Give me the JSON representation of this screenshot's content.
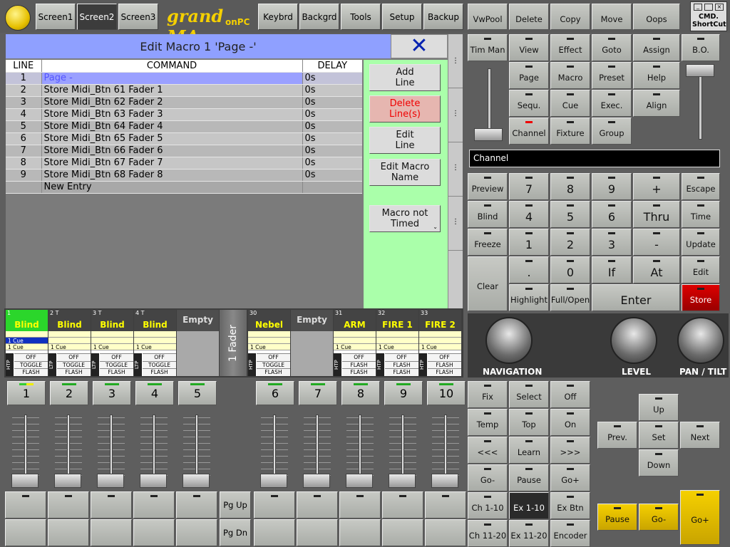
{
  "toolbar": {
    "screen1": "Screen1",
    "screen2": "Screen2",
    "screen3": "Screen3",
    "logo_main": "grand MA",
    "logo_sub": "onPC",
    "keybrd": "Keybrd",
    "backgrd": "Backgrd",
    "tools": "Tools",
    "setup": "Setup",
    "backup": "Backup",
    "cmd_shortcut": "CMD. ShortCut"
  },
  "macro": {
    "title": "Edit Macro 1 'Page -'",
    "col_line": "LINE",
    "col_command": "COMMAND",
    "col_delay": "DELAY",
    "rows": [
      {
        "line": "1",
        "command": "Page -",
        "delay": "0s"
      },
      {
        "line": "2",
        "command": "Store Midi_Btn 61 Fader 1",
        "delay": "0s"
      },
      {
        "line": "3",
        "command": "Store Midi_Btn 62 Fader 2",
        "delay": "0s"
      },
      {
        "line": "4",
        "command": "Store Midi_Btn 63 Fader 3",
        "delay": "0s"
      },
      {
        "line": "5",
        "command": "Store Midi_Btn 64 Fader 4",
        "delay": "0s"
      },
      {
        "line": "6",
        "command": "Store Midi_Btn 65 Fader 5",
        "delay": "0s"
      },
      {
        "line": "7",
        "command": "Store Midi_Btn 66 Fader 6",
        "delay": "0s"
      },
      {
        "line": "8",
        "command": "Store Midi_Btn 67 Fader 7",
        "delay": "0s"
      },
      {
        "line": "9",
        "command": "Store Midi_Btn 68 Fader 8",
        "delay": "0s"
      },
      {
        "line": "",
        "command": "New Entry",
        "delay": ""
      }
    ],
    "add_line": "Add Line",
    "delete_line": "Delete Line(s)",
    "edit_line": "Edit Line",
    "edit_name": "Edit Macro Name",
    "timed": "Macro not Timed"
  },
  "executors": [
    {
      "num": "1",
      "name": "Blind",
      "lines": [
        "1 Cue",
        "1 Cue"
      ],
      "side": "HTP",
      "btns": [
        "OFF",
        "TOGGLE",
        "FLASH"
      ]
    },
    {
      "num": "2 T",
      "name": "Blind",
      "lines": [
        "",
        "1 Cue"
      ],
      "side": "LTP",
      "btns": [
        "OFF",
        "TOGGLE",
        "FLASH"
      ]
    },
    {
      "num": "3 T",
      "name": "Blind",
      "lines": [
        "",
        "1 Cue"
      ],
      "side": "LTP",
      "btns": [
        "OFF",
        "TOGGLE",
        "FLASH"
      ]
    },
    {
      "num": "4 T",
      "name": "Blind",
      "lines": [
        "",
        "1 Cue"
      ],
      "side": "LTP",
      "btns": [
        "OFF",
        "TOGGLE",
        "FLASH"
      ]
    },
    {
      "num": "",
      "name": "Empty",
      "lines": [],
      "side": "",
      "btns": []
    },
    {
      "num": "30",
      "name": "Nebel",
      "lines": [
        "",
        "1 Cue"
      ],
      "side": "HTP",
      "btns": [
        "OFF",
        "TOGGLE",
        "FLASH"
      ]
    },
    {
      "num": "",
      "name": "Empty",
      "lines": [],
      "side": "",
      "btns": []
    },
    {
      "num": "31",
      "name": "ARM",
      "lines": [
        "",
        "1 Cue"
      ],
      "side": "HTP",
      "btns": [
        "OFF",
        "FLASH",
        "FLASH"
      ]
    },
    {
      "num": "32",
      "name": "FIRE 1",
      "lines": [
        "",
        "1 Cue"
      ],
      "side": "HTP",
      "btns": [
        "OFF",
        "FLASH",
        "FLASH"
      ]
    },
    {
      "num": "33",
      "name": "FIRE 2",
      "lines": [
        "",
        "1 Cue"
      ],
      "side": "HTP",
      "btns": [
        "OFF",
        "FLASH",
        "FLASH"
      ]
    }
  ],
  "fader_tab": "1 Fader",
  "faders": [
    "1",
    "2",
    "3",
    "4",
    "5",
    "6",
    "7",
    "8",
    "9",
    "10"
  ],
  "pg_up": "Pg Up",
  "pg_dn": "Pg Dn",
  "right_keys": {
    "vwpool": "VwPool",
    "delete": "Delete",
    "copy": "Copy",
    "move": "Move",
    "oops": "Oops",
    "timman": "Tim Man",
    "view": "View",
    "effect": "Effect",
    "goto": "Goto",
    "assign": "Assign",
    "bo": "B.O.",
    "page": "Page",
    "macro": "Macro",
    "preset": "Preset",
    "help": "Help",
    "sequ": "Sequ.",
    "cue": "Cue",
    "exec": "Exec.",
    "align": "Align",
    "channel": "Channel",
    "fixture": "Fixture",
    "group": "Group",
    "cmdline": "Channel"
  },
  "keypad": {
    "preview": "Preview",
    "blind": "Blind",
    "freeze": "Freeze",
    "clear": "Clear",
    "k7": "7",
    "k8": "8",
    "k9": "9",
    "plus": "+",
    "k4": "4",
    "k5": "5",
    "k6": "6",
    "thru": "Thru",
    "k1": "1",
    "k2": "2",
    "k3": "3",
    "minus": "-",
    "dot": ".",
    "k0": "0",
    "if": "If",
    "at": "At",
    "highlight": "Highlight",
    "fullopen": "Full/Open",
    "enter": "Enter",
    "escape": "Escape",
    "time": "Time",
    "update": "Update",
    "edit": "Edit",
    "store": "Store"
  },
  "encoders": {
    "navigation": "NAVIGATION",
    "level": "LEVEL",
    "pantilt": "PAN / TILT"
  },
  "bottom": {
    "fix": "Fix",
    "select": "Select",
    "off": "Off",
    "temp": "Temp",
    "top": "Top",
    "on": "On",
    "back": "<<<",
    "learn": "Learn",
    "fwd": ">>>",
    "gominus": "Go-",
    "pause": "Pause",
    "goplus": "Go+",
    "ch110": "Ch 1-10",
    "ex110": "Ex 1-10",
    "exbtn": "Ex Btn",
    "ch1120": "Ch 11-20",
    "ex1120": "Ex 11-20",
    "encoder": "Encoder",
    "up": "Up",
    "prev": "Prev.",
    "set": "Set",
    "next": "Next",
    "down": "Down",
    "y_pause": "Pause",
    "y_gominus": "Go-",
    "y_goplus": "Go+"
  }
}
